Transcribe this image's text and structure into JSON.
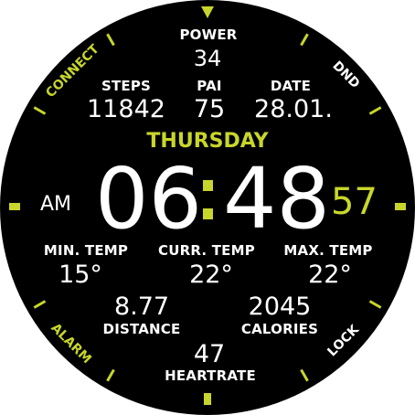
{
  "colors": {
    "accent": "#c8d62b",
    "text": "#ffffff",
    "background": "#000000"
  },
  "top_marker_icon": "triangle-down-icon",
  "shortcuts": {
    "connect": "CONNECT",
    "dnd": "DND",
    "alarm": "ALARM",
    "lock": "LOCK"
  },
  "power": {
    "label": "POWER",
    "value": "34"
  },
  "steps": {
    "label": "STEPS",
    "value": "11842"
  },
  "pai": {
    "label": "PAI",
    "value": "75"
  },
  "date": {
    "label": "DATE",
    "value": "28.01."
  },
  "day": "THURSDAY",
  "time": {
    "ampm": "AM",
    "hours": "06",
    "minutes": "48",
    "seconds": "57"
  },
  "min_temp": {
    "label": "MIN. TEMP",
    "value": "15°"
  },
  "curr_temp": {
    "label": "CURR. TEMP",
    "value": "22°"
  },
  "max_temp": {
    "label": "MAX. TEMP",
    "value": "22°"
  },
  "distance": {
    "label": "DISTANCE",
    "value": "8.77"
  },
  "calories": {
    "label": "CALORIES",
    "value": "2045"
  },
  "heartrate": {
    "label": "HEARTRATE",
    "value": "47"
  }
}
